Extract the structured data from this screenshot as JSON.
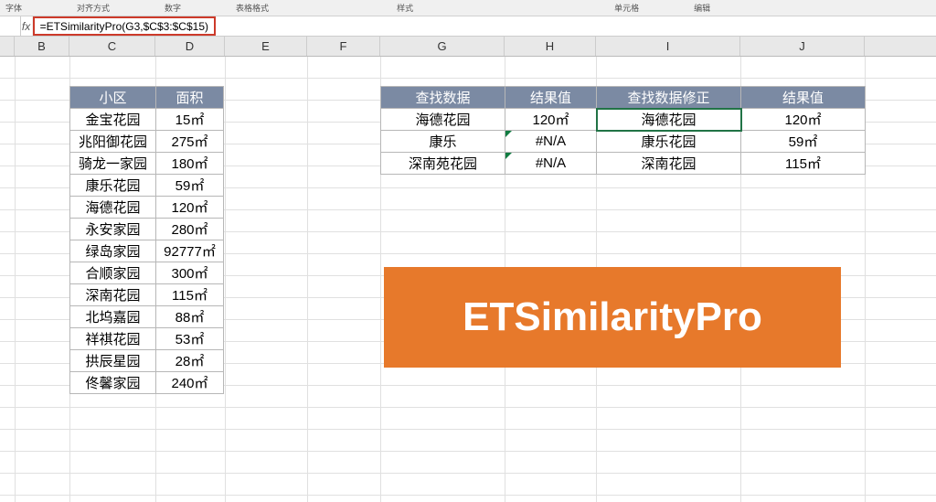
{
  "ribbon": {
    "g1": "字体",
    "g2": "对齐方式",
    "g3": "数字",
    "g4": "表格格式",
    "g5": "样式",
    "g6": "单元格",
    "g7": "编辑"
  },
  "fx": "fx",
  "formula": "=ETSimilarityPro(G3,$C$3:$C$15)",
  "cols": {
    "B": "B",
    "C": "C",
    "D": "D",
    "E": "E",
    "F": "F",
    "G": "G",
    "H": "H",
    "I": "I",
    "J": "J"
  },
  "left": {
    "h1": "小区",
    "h2": "面积",
    "rows": [
      {
        "a": "金宝花园",
        "b": "15㎡"
      },
      {
        "a": "兆阳御花园",
        "b": "275㎡"
      },
      {
        "a": "骑龙一家园",
        "b": "180㎡"
      },
      {
        "a": "康乐花园",
        "b": "59㎡"
      },
      {
        "a": "海德花园",
        "b": "120㎡"
      },
      {
        "a": "永安家园",
        "b": "280㎡"
      },
      {
        "a": "绿岛家园",
        "b": "92777㎡"
      },
      {
        "a": "合顺家园",
        "b": "300㎡"
      },
      {
        "a": "深南花园",
        "b": "115㎡"
      },
      {
        "a": "北坞嘉园",
        "b": "88㎡"
      },
      {
        "a": "祥祺花园",
        "b": "53㎡"
      },
      {
        "a": "拱辰星园",
        "b": "28㎡"
      },
      {
        "a": "佟馨家园",
        "b": "240㎡"
      }
    ]
  },
  "right": {
    "h1": "查找数据",
    "h2": "结果值",
    "h3": "查找数据修正",
    "h4": "结果值",
    "rows": [
      {
        "g": "海德花园",
        "h": "120㎡",
        "i": "海德花园",
        "j": "120㎡",
        "err": false
      },
      {
        "g": "康乐",
        "h": "#N/A",
        "i": "康乐花园",
        "j": "59㎡",
        "err": true
      },
      {
        "g": "深南苑花园",
        "h": "#N/A",
        "i": "深南花园",
        "j": "115㎡",
        "err": true
      }
    ]
  },
  "overlay": "ETSimilarityPro",
  "chart_data": {
    "type": "table",
    "tables": [
      {
        "name": "left",
        "columns": [
          "小区",
          "面积"
        ],
        "rows": [
          [
            "金宝花园",
            "15㎡"
          ],
          [
            "兆阳御花园",
            "275㎡"
          ],
          [
            "骑龙一家园",
            "180㎡"
          ],
          [
            "康乐花园",
            "59㎡"
          ],
          [
            "海德花园",
            "120㎡"
          ],
          [
            "永安家园",
            "280㎡"
          ],
          [
            "绿岛家园",
            "92777㎡"
          ],
          [
            "合顺家园",
            "300㎡"
          ],
          [
            "深南花园",
            "115㎡"
          ],
          [
            "北坞嘉园",
            "88㎡"
          ],
          [
            "祥祺花园",
            "53㎡"
          ],
          [
            "拱辰星园",
            "28㎡"
          ],
          [
            "佟馨家园",
            "240㎡"
          ]
        ]
      },
      {
        "name": "right",
        "columns": [
          "查找数据",
          "结果值",
          "查找数据修正",
          "结果值"
        ],
        "rows": [
          [
            "海德花园",
            "120㎡",
            "海德花园",
            "120㎡"
          ],
          [
            "康乐",
            "#N/A",
            "康乐花园",
            "59㎡"
          ],
          [
            "深南苑花园",
            "#N/A",
            "深南花园",
            "115㎡"
          ]
        ]
      }
    ]
  }
}
